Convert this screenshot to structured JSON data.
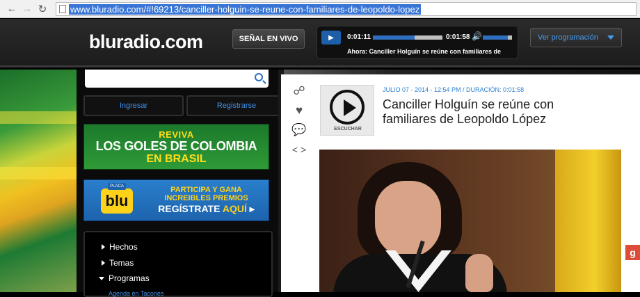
{
  "browser": {
    "url": "www.bluradio.com/#!69213/canciller-holguin-se-reune-con-familiares-de-leopoldo-lopez"
  },
  "header": {
    "logo_text": "bluradio.com",
    "live_label": "SEÑAL EN VIVO",
    "player": {
      "current_time": "0:01:11",
      "total_time": "0:01:58",
      "progress": 0.6,
      "volume": 0.85,
      "now_playing": "Ahora: Canciller Holguín se reúne con familiares de"
    },
    "schedule_label": "Ver programación"
  },
  "sidebar": {
    "login_label": "Ingresar",
    "register_label": "Registrarse",
    "banner_colombia": {
      "line1": "REVIVA",
      "line2": "LOS GOLES DE COLOMBIA",
      "line3": "EN BRASIL"
    },
    "banner_placa": {
      "placa": "PLACA",
      "brand": "blu",
      "line1": "PARTICIPA Y GANA",
      "line2": "INCREIBLES PREMIOS",
      "line3": "REGÍSTRATE",
      "line3_highlight": "AQUÍ"
    },
    "menu": [
      {
        "label": "Hechos",
        "expanded": false
      },
      {
        "label": "Temas",
        "expanded": false
      },
      {
        "label": "Programas",
        "expanded": true
      }
    ],
    "submenu_first": "Agenda en Tacones"
  },
  "article": {
    "audio_label": "ESCUCHAR",
    "meta": "JULIO 07 - 2014 - 12:54 PM / DURACIÓN: 0:01:58",
    "headline": "Canciller Holguín se reúne con familiares de Leopoldo López"
  },
  "colors": {
    "accent_blue": "#2a7fd0",
    "header_bg": "#1c1c1c",
    "gplus": "#dd4b39"
  }
}
